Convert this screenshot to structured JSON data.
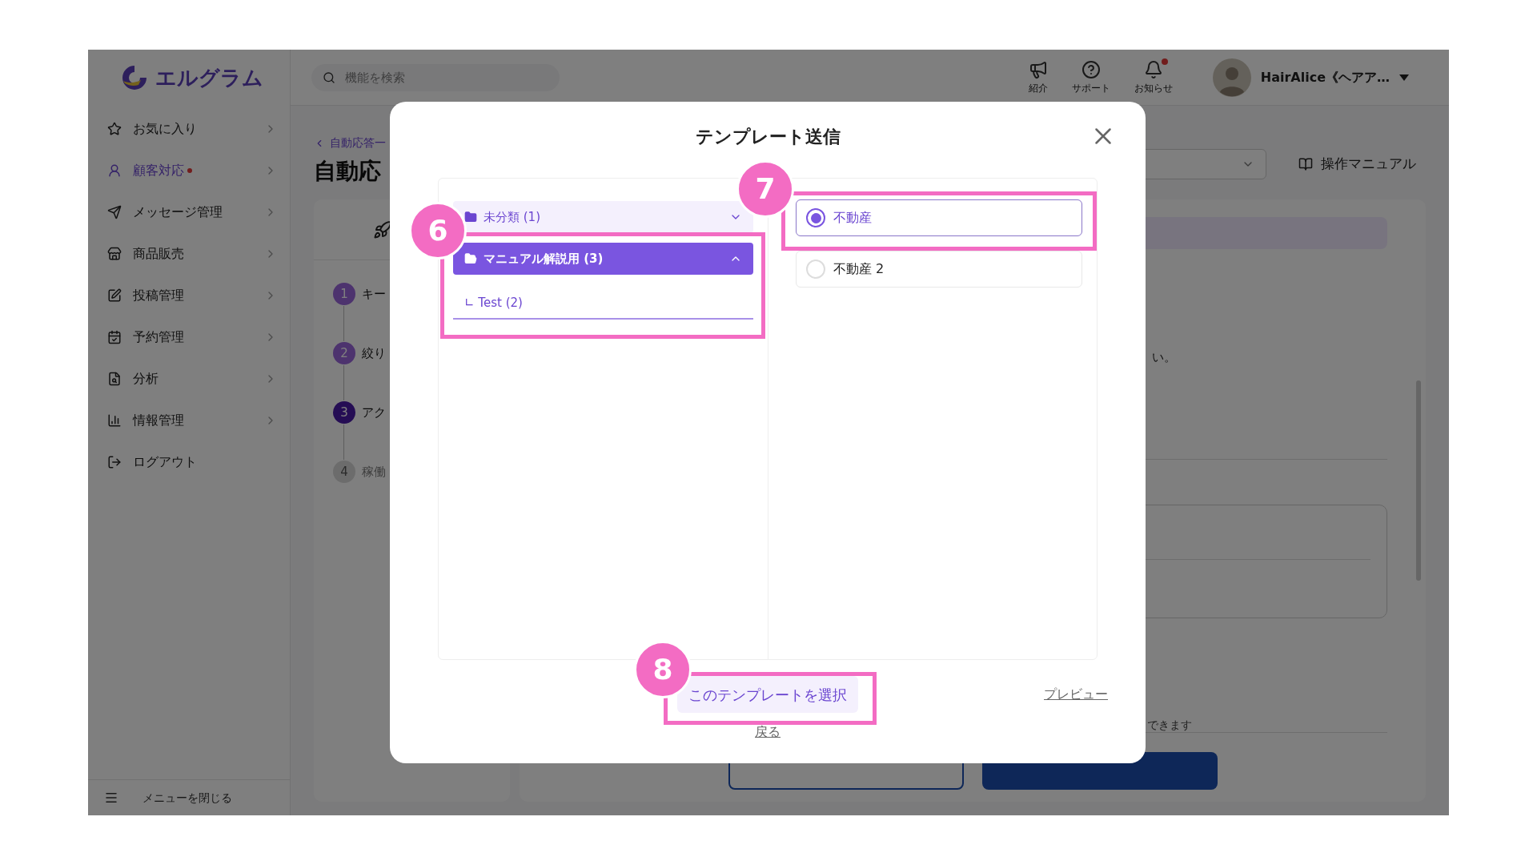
{
  "logo": {
    "text": "エルグラム"
  },
  "search": {
    "placeholder": "機能を検索"
  },
  "header_icons": [
    {
      "kind": "megaphone",
      "label": "紹介",
      "badge": false
    },
    {
      "kind": "help",
      "label": "サポート",
      "badge": false
    },
    {
      "kind": "bell",
      "label": "お知らせ",
      "badge": true
    }
  ],
  "user": {
    "name": "HairAlice《ヘアア…"
  },
  "sidebar": {
    "items": [
      {
        "kind": "star",
        "label": "お気に入り",
        "selected": false,
        "badge": false,
        "submenu": true
      },
      {
        "kind": "customer",
        "label": "顧客対応",
        "selected": true,
        "badge": true,
        "submenu": true
      },
      {
        "kind": "send",
        "label": "メッセージ管理",
        "selected": false,
        "badge": false,
        "submenu": true
      },
      {
        "kind": "shop",
        "label": "商品販売",
        "selected": false,
        "badge": false,
        "submenu": true
      },
      {
        "kind": "post",
        "label": "投稿管理",
        "selected": false,
        "badge": false,
        "submenu": true
      },
      {
        "kind": "calendar",
        "label": "予約管理",
        "selected": false,
        "badge": false,
        "submenu": true
      },
      {
        "kind": "analysis",
        "label": "分析",
        "selected": false,
        "badge": false,
        "submenu": true
      },
      {
        "kind": "chart",
        "label": "情報管理",
        "selected": false,
        "badge": false,
        "submenu": true
      },
      {
        "kind": "logout",
        "label": "ログアウト",
        "selected": false,
        "badge": false,
        "submenu": false
      }
    ],
    "collapse": "メニューを閉じる"
  },
  "page": {
    "breadcrumb": "自動応答一",
    "title": "自動応",
    "manual_link": "操作マニュアル",
    "steps": [
      {
        "number": "1",
        "label": "キー",
        "done": true,
        "active": false
      },
      {
        "number": "2",
        "label": "絞り",
        "done": true,
        "active": false
      },
      {
        "number": "3",
        "label": "アク",
        "done": false,
        "active": true
      },
      {
        "number": "4",
        "label": "稼働",
        "done": false,
        "active": false
      }
    ],
    "note_fragment": "い。",
    "hint_fragment": "できます"
  },
  "modal": {
    "title": "テンプレート送信",
    "folders": [
      {
        "label": "未分類 (1)",
        "expanded": false,
        "selected": false
      },
      {
        "label": "マニュアル解説用 (3)",
        "expanded": true,
        "selected": true,
        "children": [
          {
            "label": "∟ Test (2)",
            "selected": false
          }
        ]
      }
    ],
    "templates": [
      {
        "label": "不動産",
        "selected": true
      },
      {
        "label": "不動産 2",
        "selected": false
      }
    ],
    "select_button": "このテンプレートを選択",
    "preview_link": "プレビュー",
    "back_link": "戻る"
  },
  "annotations": [
    {
      "number": "6"
    },
    {
      "number": "7"
    },
    {
      "number": "8"
    }
  ]
}
